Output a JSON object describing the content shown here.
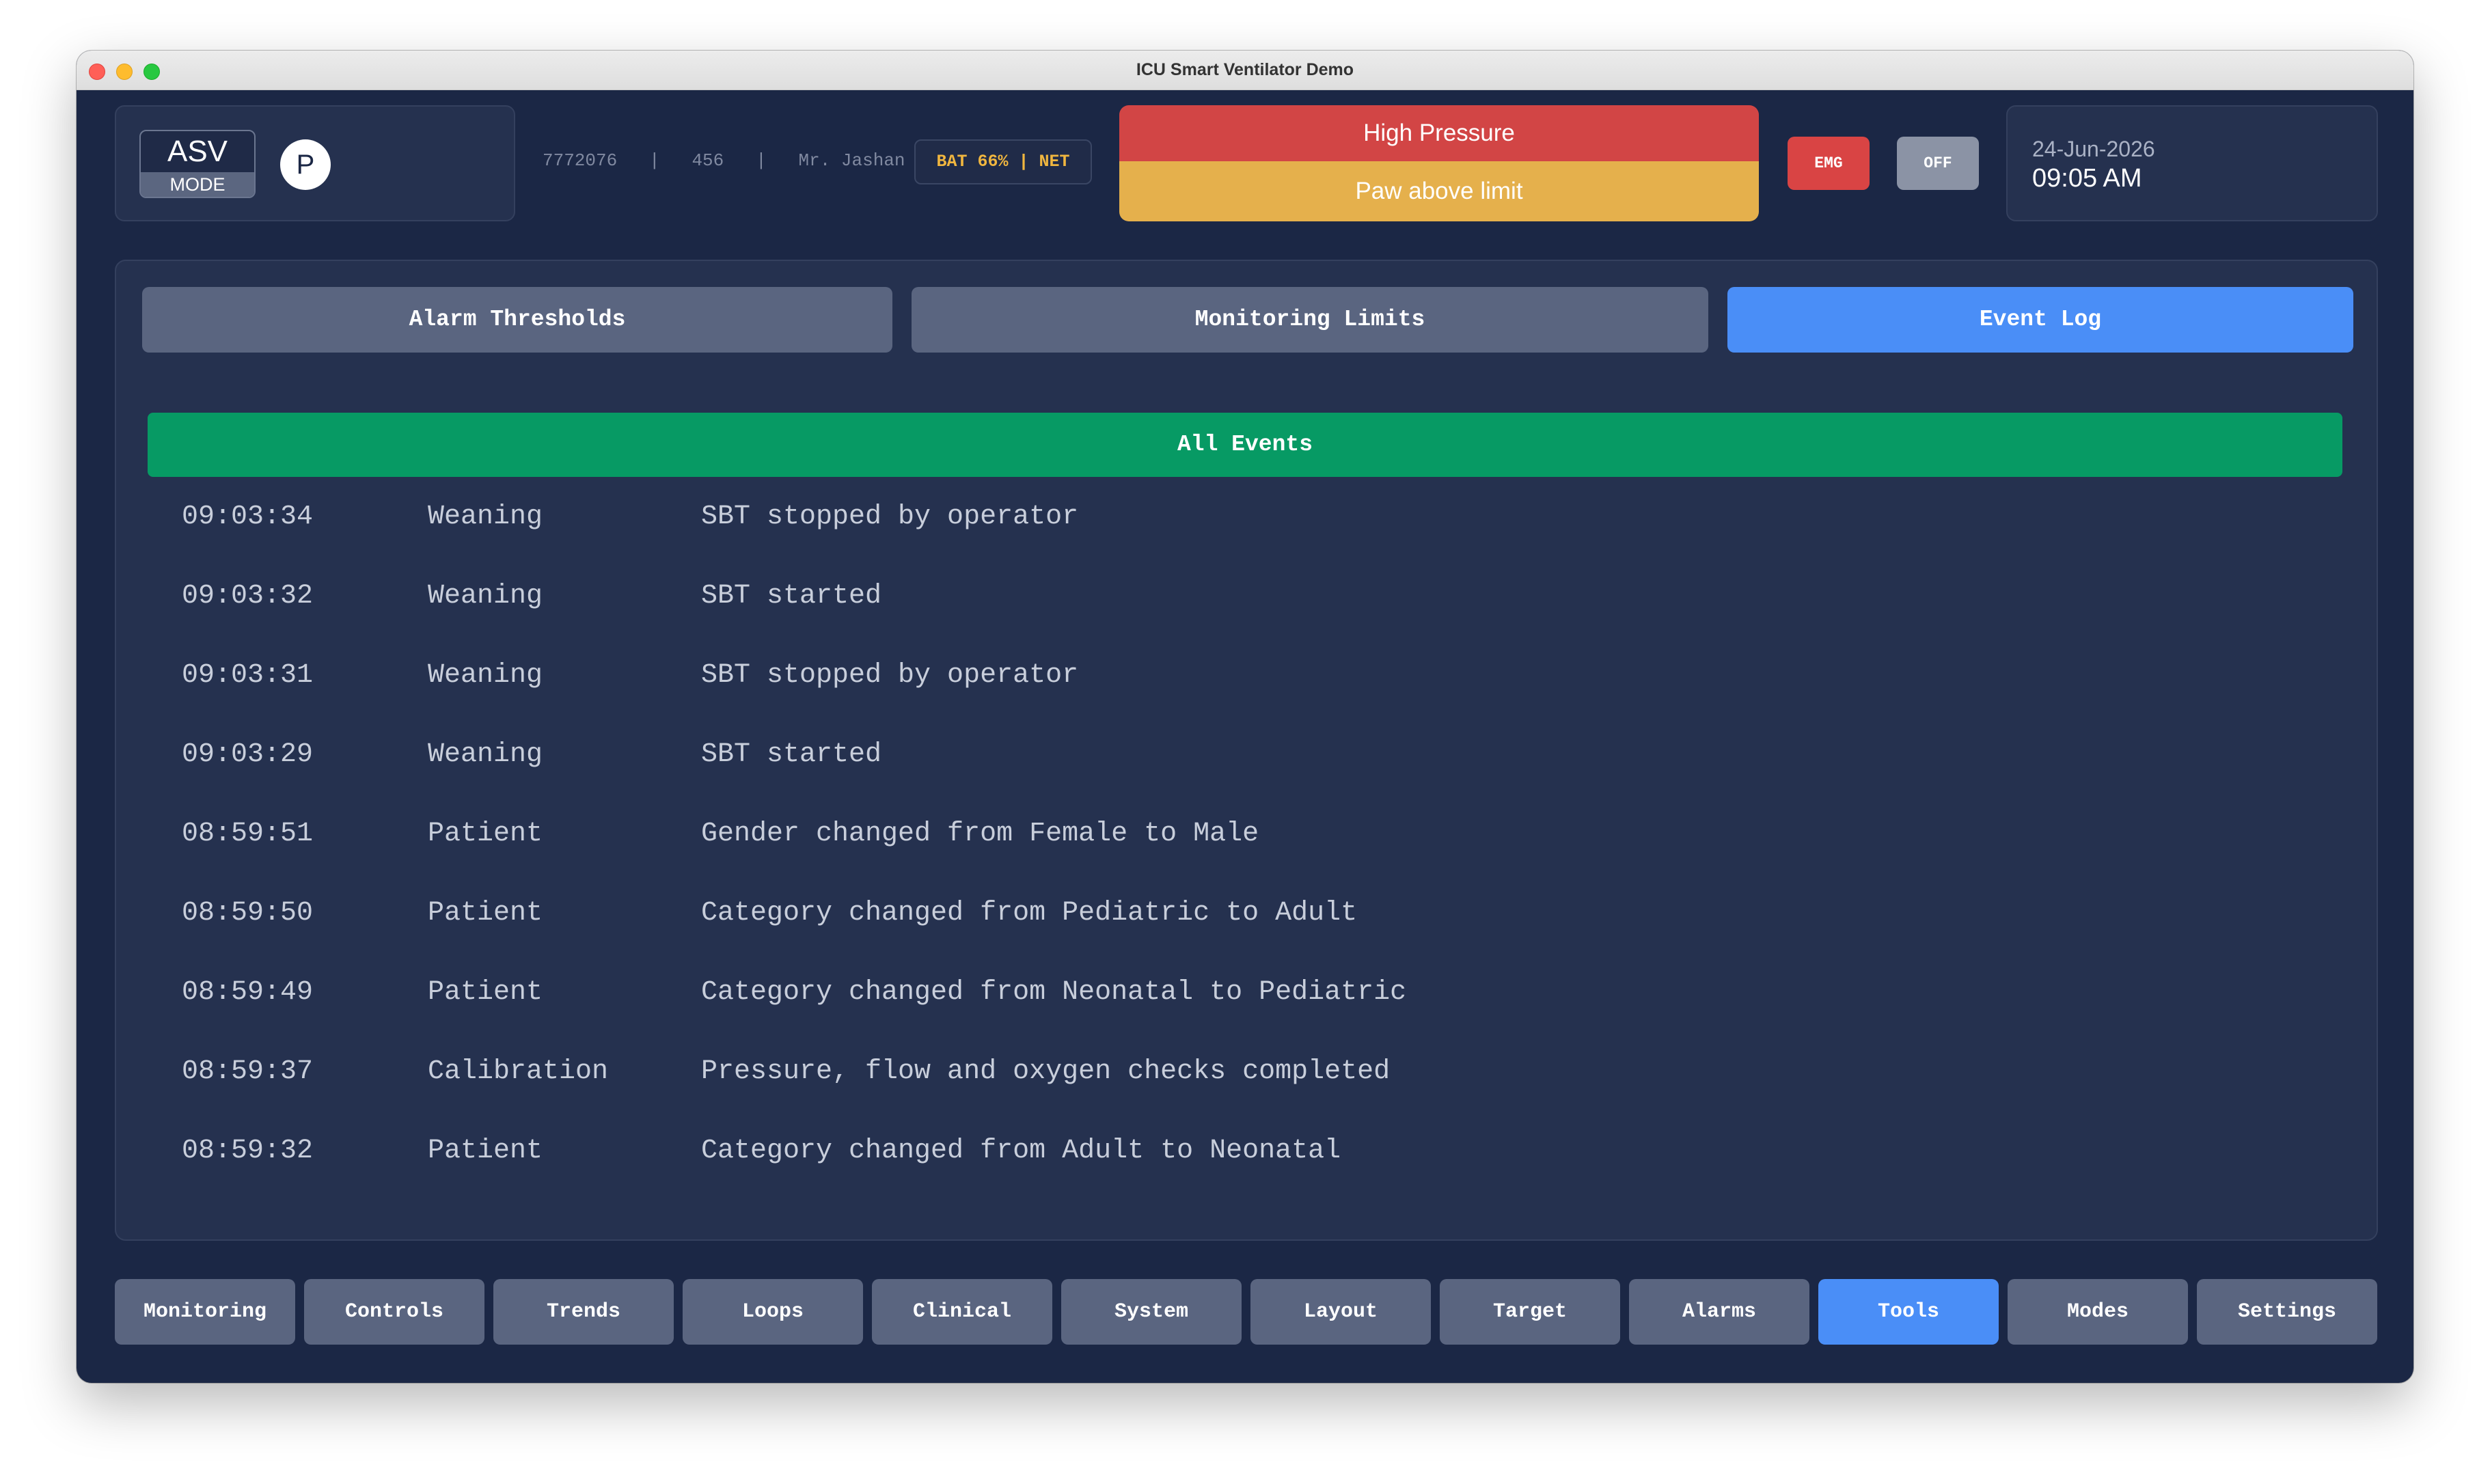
{
  "window": {
    "title": "ICU Smart Ventilator Demo"
  },
  "header": {
    "mode_value": "ASV",
    "mode_label": "MODE",
    "profile_initial": "P",
    "patient_id": "7772076",
    "bed": "456",
    "patient_name": "Mr. Jashan",
    "separator": "|",
    "status_badge": "BAT 66% | NET",
    "alarm_primary": "High Pressure",
    "alarm_secondary": "Paw above limit",
    "emg_label": "EMG",
    "off_label": "OFF",
    "date": "24-Jun-2026",
    "time": "09:05 AM"
  },
  "tabs": [
    {
      "label": "Alarm Thresholds",
      "active": false
    },
    {
      "label": "Monitoring Limits",
      "active": false
    },
    {
      "label": "Event Log",
      "active": true
    }
  ],
  "filter": {
    "label": "All Events"
  },
  "events": [
    {
      "time": "09:03:34",
      "category": "Weaning",
      "message": "SBT stopped by operator"
    },
    {
      "time": "09:03:32",
      "category": "Weaning",
      "message": "SBT started"
    },
    {
      "time": "09:03:31",
      "category": "Weaning",
      "message": "SBT stopped by operator"
    },
    {
      "time": "09:03:29",
      "category": "Weaning",
      "message": "SBT started"
    },
    {
      "time": "08:59:51",
      "category": "Patient",
      "message": "Gender changed from Female to Male"
    },
    {
      "time": "08:59:50",
      "category": "Patient",
      "message": "Category changed from Pediatric to Adult"
    },
    {
      "time": "08:59:49",
      "category": "Patient",
      "message": "Category changed from Neonatal to Pediatric"
    },
    {
      "time": "08:59:37",
      "category": "Calibration",
      "message": "Pressure, flow and oxygen checks completed"
    },
    {
      "time": "08:59:32",
      "category": "Patient",
      "message": "Category changed from Adult to Neonatal"
    }
  ],
  "nav": [
    {
      "label": "Monitoring",
      "active": false
    },
    {
      "label": "Controls",
      "active": false
    },
    {
      "label": "Trends",
      "active": false
    },
    {
      "label": "Loops",
      "active": false
    },
    {
      "label": "Clinical",
      "active": false
    },
    {
      "label": "System",
      "active": false
    },
    {
      "label": "Layout",
      "active": false
    },
    {
      "label": "Target",
      "active": false
    },
    {
      "label": "Alarms",
      "active": false
    },
    {
      "label": "Tools",
      "active": true
    },
    {
      "label": "Modes",
      "active": false
    },
    {
      "label": "Settings",
      "active": false
    }
  ],
  "colors": {
    "background": "#1b2745",
    "panel": "#25314f",
    "button": "#5a6580",
    "active": "#4a8ef7",
    "filter_green": "#079a64",
    "alarm_red": "#d24545",
    "alarm_amber": "#e5b04c",
    "badge_text": "#f0b63f"
  }
}
